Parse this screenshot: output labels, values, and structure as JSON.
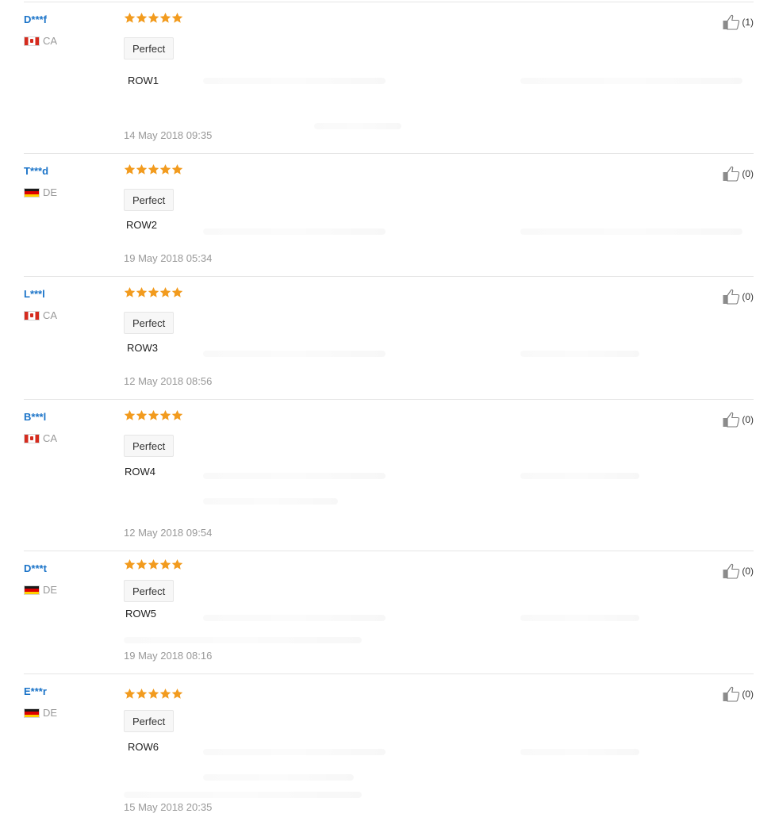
{
  "icons": {
    "star": "star-icon",
    "helpful": "thumbs-up-icon",
    "flag_ca": "flag-canada-icon",
    "flag_de": "flag-germany-icon"
  },
  "colors": {
    "user_link": "#1a73c8",
    "star": "#f29b1e",
    "meta_text": "#999999",
    "divider": "#e6e6e6"
  },
  "reviews": [
    {
      "user": "D***f",
      "country": "CA",
      "flag": "ca",
      "rating": 5,
      "tag": "Perfect",
      "text": "ROW1",
      "date": "14 May 2018 09:35",
      "helpful": "(1)"
    },
    {
      "user": "T***d",
      "country": "DE",
      "flag": "de",
      "rating": 5,
      "tag": "Perfect",
      "text": "ROW2",
      "date": "19 May 2018 05:34",
      "helpful": "(0)"
    },
    {
      "user": "L***l",
      "country": "CA",
      "flag": "ca",
      "rating": 5,
      "tag": "Perfect",
      "text": "ROW3",
      "date": "12 May 2018 08:56",
      "helpful": "(0)"
    },
    {
      "user": "B***l",
      "country": "CA",
      "flag": "ca",
      "rating": 5,
      "tag": "Perfect",
      "text": "ROW4",
      "date": "12 May 2018 09:54",
      "helpful": "(0)"
    },
    {
      "user": "D***t",
      "country": "DE",
      "flag": "de",
      "rating": 5,
      "tag": "Perfect",
      "text": "ROW5",
      "date": "19 May 2018 08:16",
      "helpful": "(0)"
    },
    {
      "user": "E***r",
      "country": "DE",
      "flag": "de",
      "rating": 5,
      "tag": "Perfect",
      "text": "ROW6",
      "date": "15 May 2018 20:35",
      "helpful": "(0)"
    }
  ]
}
